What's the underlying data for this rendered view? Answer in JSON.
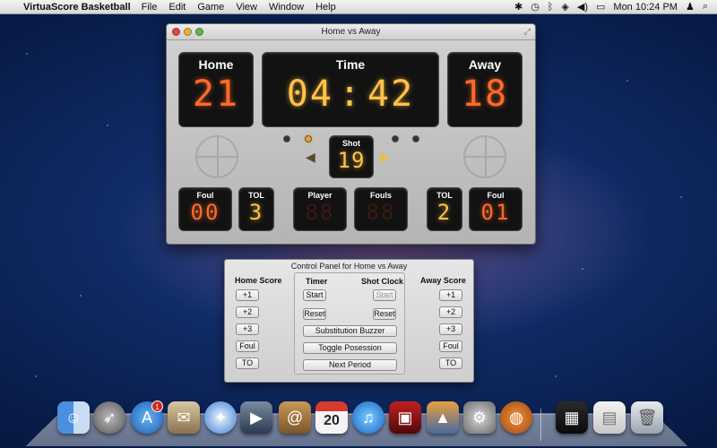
{
  "menubar": {
    "app_name": "VirtuaScore Basketball",
    "items": [
      "File",
      "Edit",
      "Game",
      "View",
      "Window",
      "Help"
    ],
    "clock": "Mon 10:24 PM"
  },
  "scoreboard": {
    "window_title": "Home vs Away",
    "home_label": "Home",
    "home_score": "21",
    "time_label": "Time",
    "time_minutes": "04",
    "time_seconds": "42",
    "time_colon": ":",
    "away_label": "Away",
    "away_score": "18",
    "shot_label": "Shot",
    "shot_clock": "19",
    "home_foul_label": "Foul",
    "home_foul": "00",
    "home_tol_label": "TOL",
    "home_tol": "3",
    "player_label": "Player",
    "player_value": "88",
    "fouls_label": "Fouls",
    "fouls_value": "88",
    "away_tol_label": "TOL",
    "away_tol": "2",
    "away_foul_label": "Foul",
    "away_foul": "01"
  },
  "control_panel": {
    "title": "Control Panel for Home vs Away",
    "home_score_label": "Home Score",
    "away_score_label": "Away Score",
    "timer_label": "Timer",
    "shot_clock_label": "Shot Clock",
    "plus1": "+1",
    "plus2": "+2",
    "plus3": "+3",
    "foul": "Foul",
    "to": "TO",
    "timer_start": "Start",
    "timer_reset": "Reset",
    "shot_start": "Start",
    "shot_reset": "Reset",
    "substitution": "Substitution Buzzer",
    "toggle": "Toggle Posession",
    "next_period": "Next Period"
  },
  "dock": {
    "calendar_day": "20",
    "badge": "1",
    "icons": [
      "finder-icon",
      "launchpad-icon",
      "app-store-icon",
      "mail-stamp-icon",
      "safari-icon",
      "facetime-icon",
      "address-book-icon",
      "ical-icon",
      "itunes-icon",
      "photo-booth-icon",
      "iphoto-icon",
      "system-preferences-icon",
      "basketball-app-icon",
      "activity-monitor-icon",
      "documents-icon",
      "trash-icon"
    ]
  }
}
